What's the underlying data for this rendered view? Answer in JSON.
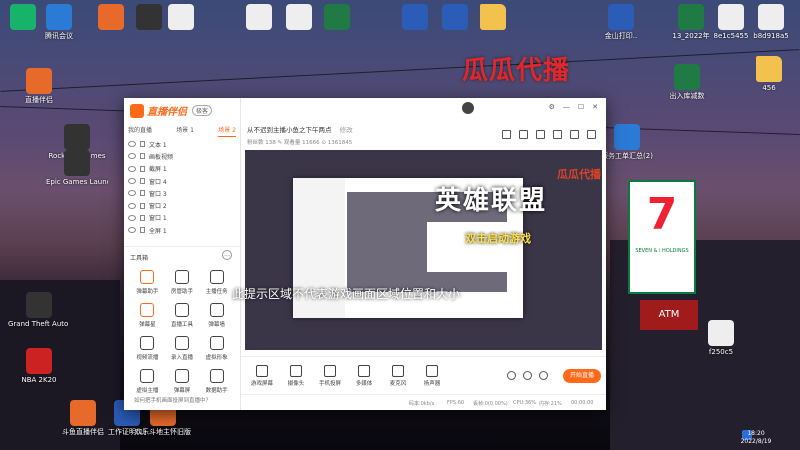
{
  "desktop": {
    "overlay_title": "瓜瓜代播",
    "icons": [
      {
        "label": "",
        "kind": "green"
      },
      {
        "label": "腾讯会议",
        "kind": "blue"
      },
      {
        "label": "",
        "kind": "app"
      },
      {
        "label": "",
        "kind": "dark"
      },
      {
        "label": "",
        "kind": "white"
      },
      {
        "label": "",
        "kind": "white"
      },
      {
        "label": "",
        "kind": "white"
      },
      {
        "label": "",
        "kind": "excel"
      },
      {
        "label": "",
        "kind": "word"
      },
      {
        "label": "",
        "kind": "word"
      },
      {
        "label": "",
        "kind": "folder"
      },
      {
        "label": "金山打印..",
        "kind": "word"
      },
      {
        "label": "13_2022年",
        "kind": "excel"
      },
      {
        "label": "8e1c5455",
        "kind": "white"
      },
      {
        "label": "b8d918a5",
        "kind": "white"
      },
      {
        "label": "直播伴侣",
        "kind": "app"
      },
      {
        "label": "Rockstar Games",
        "kind": "dark"
      },
      {
        "label": "Epic Games Launcher",
        "kind": "dark"
      },
      {
        "label": "Grand Theft Auto V",
        "kind": "dark"
      },
      {
        "label": "NBA 2K20",
        "kind": "red"
      },
      {
        "label": "斗鱼直播伴侣",
        "kind": "app"
      },
      {
        "label": "工作证明(1)",
        "kind": "word"
      },
      {
        "label": "欢乐斗地主怀旧版",
        "kind": "app"
      },
      {
        "label": "出入库减数",
        "kind": "excel"
      },
      {
        "label": "服务工单汇总(2)",
        "kind": "blue"
      },
      {
        "label": "456",
        "kind": "folder"
      },
      {
        "label": "f250c5",
        "kind": "white"
      }
    ],
    "store_sign": {
      "number": "7",
      "name": "SEVEN & i HOLDINGS"
    },
    "atm_text": "ATM",
    "clock": {
      "time": "18:20",
      "date": "2022/8/19"
    }
  },
  "app": {
    "brand": "直播伴侣",
    "version": "极客",
    "scene_tabs": [
      "我的直播",
      "场景 1",
      "场景 2"
    ],
    "active_tab": 2,
    "scenes": [
      {
        "label": "文本 1"
      },
      {
        "label": "画板视频"
      },
      {
        "label": "截屏 1"
      },
      {
        "label": "窗口 4"
      },
      {
        "label": "窗口 3"
      },
      {
        "label": "窗口 2"
      },
      {
        "label": "窗口 1"
      },
      {
        "label": "全屏 1"
      }
    ],
    "toolbox_title": "工具箱",
    "tools": [
      {
        "label": "弹幕助手",
        "accent": true
      },
      {
        "label": "房管助手",
        "accent": false
      },
      {
        "label": "主播任务",
        "accent": false
      },
      {
        "label": "弹幕星",
        "accent": true
      },
      {
        "label": "直播工具",
        "accent": false
      },
      {
        "label": "弹幕墙",
        "accent": false
      },
      {
        "label": "视频流播",
        "accent": false
      },
      {
        "label": "录入直播",
        "accent": false
      },
      {
        "label": "虚拟形象",
        "accent": false
      },
      {
        "label": "虚拟主播",
        "accent": false
      },
      {
        "label": "弹幕屏",
        "accent": false
      },
      {
        "label": "数据助手",
        "accent": false
      }
    ],
    "footer_tip": "如何把手机画面投屏到直播中？",
    "stream_title": "从不迟到主播小鱼之下午两点",
    "stream_tag": "修改",
    "stream_stats": "粉丝数  138 ✎    观看量  11666  ⊙  1361845",
    "window_controls": [
      "⚙",
      "—",
      "☐",
      "✕"
    ],
    "preview": {
      "overlay_title": "英雄联盟",
      "overlay_sub": "双击启动游戏",
      "overlay_brand": "瓜瓜代播",
      "hint": "此提示区域不代表游戏画面区域位置和大小"
    },
    "bottom_tools": [
      {
        "label": "游戏屏幕"
      },
      {
        "label": "摄像头"
      },
      {
        "label": "手机投屏"
      },
      {
        "label": "多媒体"
      },
      {
        "label": "麦克风"
      },
      {
        "label": "扬声器"
      }
    ],
    "start_button": "开始直播",
    "status": {
      "bitrate": "码率:0kb/s",
      "fps": "FPS:60",
      "dropped": "丢帧:0(0.00%)",
      "cpu": "CPU:36%",
      "memory": "内存:21%",
      "time": "00:00:00"
    }
  }
}
